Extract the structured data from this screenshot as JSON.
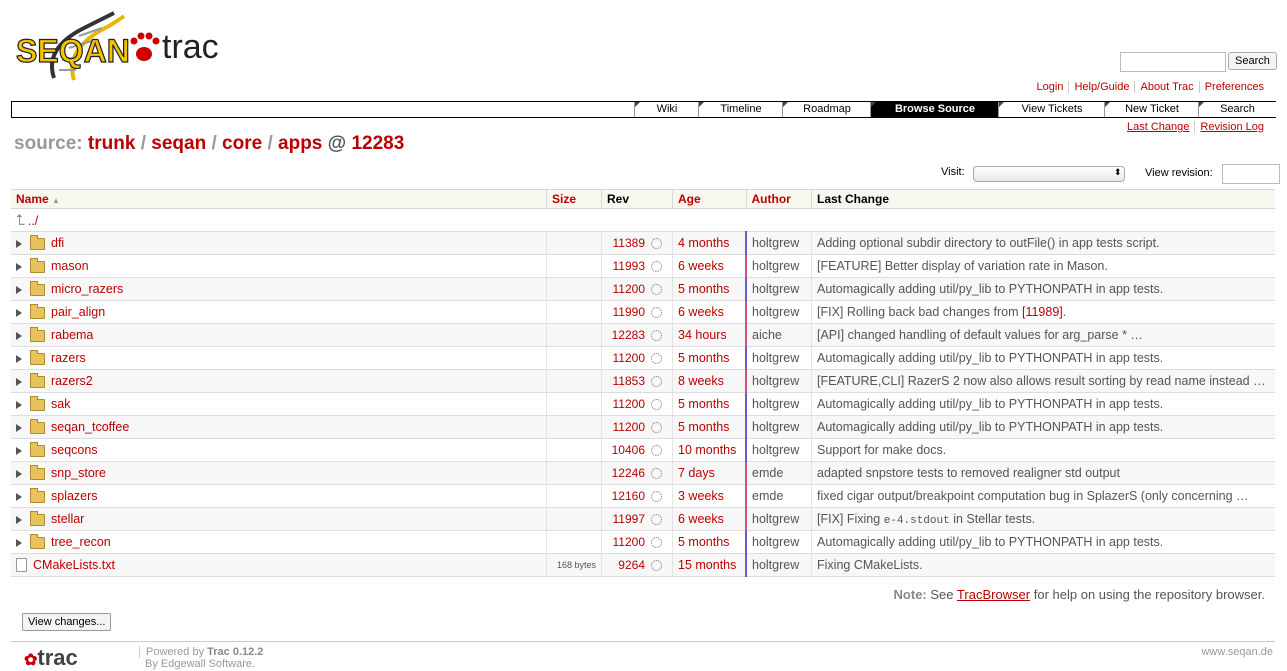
{
  "logo": {
    "brand_text": "SEQAN",
    "trac_text": "trac"
  },
  "search": {
    "button_label": "Search",
    "placeholder": ""
  },
  "metanav": [
    "Login",
    "Help/Guide",
    "About Trac",
    "Preferences"
  ],
  "mainnav": [
    "Wiki",
    "Timeline",
    "Roadmap",
    "Browse Source",
    "View Tickets",
    "New Ticket",
    "Search"
  ],
  "ctxtnav": [
    "Last Change",
    "Revision Log"
  ],
  "path": {
    "label": "source:",
    "parts": [
      "trunk",
      "seqan",
      "core",
      "apps"
    ],
    "at": "@",
    "revision": "12283"
  },
  "visit_label": "Visit:",
  "visit_value": "",
  "view_revision_label": "View revision:",
  "columns": [
    "Name",
    "Size",
    "Rev",
    "Age",
    "Author",
    "Last Change"
  ],
  "up_label": "../",
  "rows": [
    {
      "name": "dfi",
      "size": "",
      "rev": "11389",
      "age": "4 months",
      "author": "holtgrew",
      "change": "Adding optional subdir directory to outFile() in app tests script."
    },
    {
      "name": "mason",
      "size": "",
      "rev": "11993",
      "age": "6 weeks",
      "author": "holtgrew",
      "change": "[FEATURE] Better display of variation rate in Mason."
    },
    {
      "name": "micro_razers",
      "size": "",
      "rev": "11200",
      "age": "5 months",
      "author": "holtgrew",
      "change": "Automagically adding util/py_lib to PYTHONPATH in app tests."
    },
    {
      "name": "pair_align",
      "size": "",
      "rev": "11990",
      "age": "6 weeks",
      "author": "holtgrew",
      "change": "[FIX] Rolling back bad changes from",
      "change_link": "[11989]",
      "change_after": "."
    },
    {
      "name": "rabema",
      "size": "",
      "rev": "12283",
      "age": "34 hours",
      "author": "aiche",
      "change": "[API] changed handling of default values for arg_parse * …"
    },
    {
      "name": "razers",
      "size": "",
      "rev": "11200",
      "age": "5 months",
      "author": "holtgrew",
      "change": "Automagically adding util/py_lib to PYTHONPATH in app tests."
    },
    {
      "name": "razers2",
      "size": "",
      "rev": "11853",
      "age": "8 weeks",
      "author": "holtgrew",
      "change": "[FEATURE,CLI] RazerS 2 now also allows result sorting by read name instead …"
    },
    {
      "name": "sak",
      "size": "",
      "rev": "11200",
      "age": "5 months",
      "author": "holtgrew",
      "change": "Automagically adding util/py_lib to PYTHONPATH in app tests."
    },
    {
      "name": "seqan_tcoffee",
      "size": "",
      "rev": "11200",
      "age": "5 months",
      "author": "holtgrew",
      "change": "Automagically adding util/py_lib to PYTHONPATH in app tests."
    },
    {
      "name": "seqcons",
      "size": "",
      "rev": "10406",
      "age": "10 months",
      "author": "holtgrew",
      "change": "Support for make docs."
    },
    {
      "name": "snp_store",
      "size": "",
      "rev": "12246",
      "age": "7 days",
      "author": "emde",
      "change": "adapted snpstore tests to removed realigner std output"
    },
    {
      "name": "splazers",
      "size": "",
      "rev": "12160",
      "age": "3 weeks",
      "author": "emde",
      "change": "fixed cigar output/breakpoint computation bug in SplazerS (only concerning …"
    },
    {
      "name": "stellar",
      "size": "",
      "rev": "11997",
      "age": "6 weeks",
      "author": "holtgrew",
      "change": "[FIX] Fixing",
      "change_code": "e-4.stdout",
      "change_after": "in Stellar tests."
    },
    {
      "name": "tree_recon",
      "size": "",
      "rev": "11200",
      "age": "5 months",
      "author": "holtgrew",
      "change": "Automagically adding util/py_lib to PYTHONPATH in app tests."
    }
  ],
  "file_row": {
    "name": "CMakeLists.txt",
    "size": "168 bytes",
    "rev": "9264",
    "age": "15 months",
    "author": "holtgrew",
    "change": "Fixing CMakeLists."
  },
  "note": {
    "label": "Note:",
    "text_before": "See",
    "link": "TracBrowser",
    "text_after": "for help on using the repository browser."
  },
  "view_changes_label": "View changes...",
  "footer": {
    "logo": "trac",
    "powered_by": "Powered by",
    "trac_version": "Trac 0.12.2",
    "by_line": "By Edgewall Software.",
    "right": "www.seqan.de"
  },
  "colors": {
    "link": "#bb0000",
    "active_tab_bg": "#000000",
    "age_bar_old": "#6a5acd",
    "age_bar_new": "#d05080"
  }
}
